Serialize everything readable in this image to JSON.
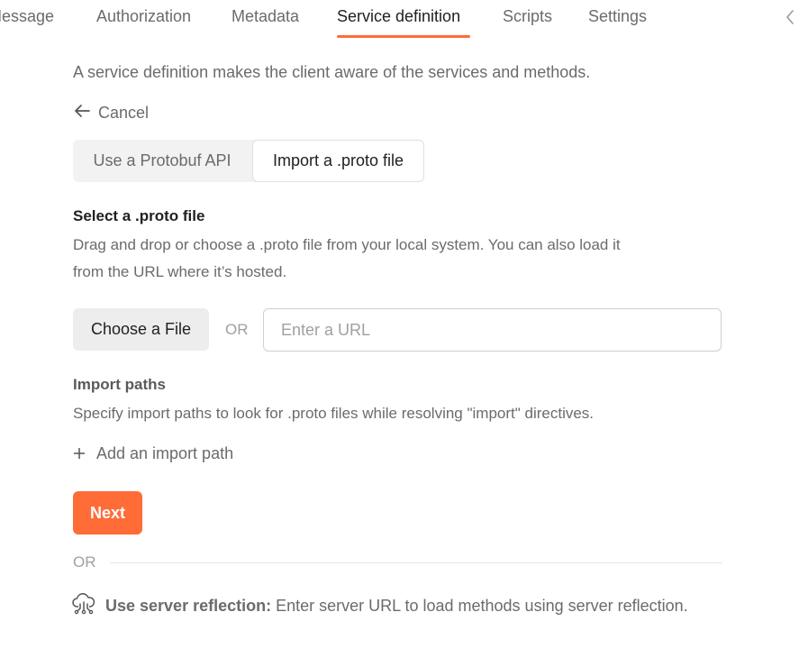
{
  "tabs": [
    {
      "label": "Message",
      "active": false
    },
    {
      "label": "Authorization",
      "active": false
    },
    {
      "label": "Metadata",
      "active": false
    },
    {
      "label": "Service definition",
      "active": true
    },
    {
      "label": "Scripts",
      "active": false
    },
    {
      "label": "Settings",
      "active": false
    }
  ],
  "accent_color": "#ff6c37",
  "icons": {
    "cancel": "arrow-left-icon",
    "collapse": "chevron-left-icon",
    "add": "plus-icon",
    "reflection": "cloud-network-icon"
  },
  "intro": "A service definition makes the client aware of the services and methods.",
  "cancel_label": "Cancel",
  "segments": [
    {
      "label": "Use a Protobuf API",
      "selected": false
    },
    {
      "label": "Import a .proto file",
      "selected": true
    }
  ],
  "select_section": {
    "title": "Select a .proto file",
    "description_line1": "Drag and drop or choose a .proto file from your local system. You can also load it",
    "description_line2": "from the URL where it’s hosted.",
    "choose_button": "Choose a File",
    "or_label": "OR",
    "url_placeholder": "Enter a URL",
    "url_value": ""
  },
  "import_section": {
    "title": "Import paths",
    "description": "Specify import paths to look for .proto files while resolving \"import\" directives.",
    "add_label": "Add an import path"
  },
  "next_button": "Next",
  "bottom_or": "OR",
  "reflection": {
    "title": "Use server reflection:",
    "description": "Enter server URL to load methods using server reflection."
  }
}
